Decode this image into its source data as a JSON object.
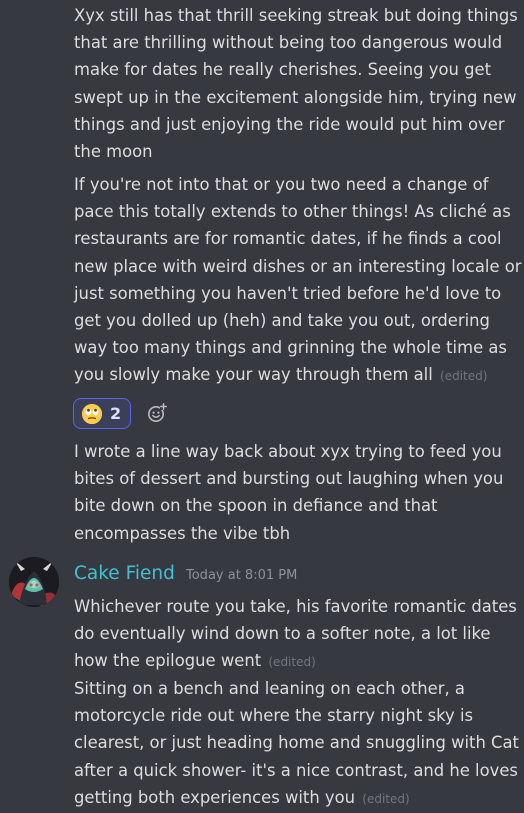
{
  "messages": {
    "block1_text": "Xyx still has that thrill seeking streak but doing things that are thrilling without being too dangerous would make for dates he really cherishes. Seeing you get swept up in the excitement alongside him, trying new things and just enjoying the ride would put him over the moon",
    "block2_text": "If you're not into that or you two need a change of pace this totally extends to other things! As cliché as restaurants are for romantic dates, if he finds a cool new place with weird dishes or an interesting locale or just something you haven't tried before he'd love to get you dolled up (heh) and take you out, ordering way too many things and grinning the whole time as you slowly make your way through them all",
    "block2_edited": "(edited)",
    "reaction": {
      "emoji_icon": "face-with-rolling-eyes-emoji",
      "count": "2"
    },
    "block3_text": "I wrote a line way back about xyx trying to feed you bites of dessert and bursting out laughing when you bite down on the spoon in defiance and that encompasses the vibe tbh"
  },
  "author2": {
    "username": "Cake Fiend",
    "timestamp": "Today at 8:01 PM",
    "username_color": "#3fc3d0"
  },
  "messages2": {
    "block1_text": "Whichever route you take, his favorite romantic dates do eventually wind down to a softer note, a lot like how the epilogue went",
    "block1_edited": "(edited)",
    "block2_text": "Sitting on a bench and leaning on each other, a motorcycle ride out where the starry night sky is clearest, or just heading home and snuggling with Cat after a quick shower- it's a nice contrast, and he loves getting both experiences with you",
    "block2_edited": "(edited)"
  },
  "colors": {
    "background": "#36393f",
    "text": "#dcddde",
    "muted": "#72767d",
    "reaction_border": "#5865f2"
  }
}
